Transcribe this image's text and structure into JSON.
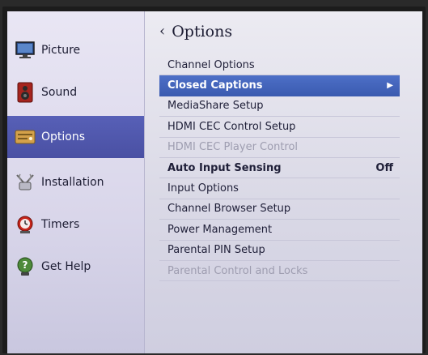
{
  "sidebar": {
    "items": [
      {
        "label": "Picture",
        "icon": "picture-icon"
      },
      {
        "label": "Sound",
        "icon": "speaker-icon"
      },
      {
        "label": "Options",
        "icon": "options-icon"
      },
      {
        "label": "Installation",
        "icon": "antenna-icon"
      },
      {
        "label": "Timers",
        "icon": "timer-icon"
      },
      {
        "label": "Get Help",
        "icon": "help-icon"
      }
    ],
    "active_index": 2
  },
  "main": {
    "title": "Options",
    "back_icon": "chevron-left-icon",
    "menu": [
      {
        "label": "Channel Options"
      },
      {
        "label": "Closed Captions",
        "selected": true,
        "has_submenu": true
      },
      {
        "label": "MediaShare Setup"
      },
      {
        "label": "HDMI CEC Control Setup"
      },
      {
        "label": "HDMI CEC Player Control",
        "disabled": true
      },
      {
        "label": "Auto Input Sensing",
        "value": "Off"
      },
      {
        "label": "Input Options"
      },
      {
        "label": "Channel Browser Setup"
      },
      {
        "label": "Power Management"
      },
      {
        "label": "Parental PIN Setup"
      },
      {
        "label": "Parental Control and Locks",
        "disabled": true
      }
    ]
  },
  "colors": {
    "sidebar_active": "#4a50a3",
    "menu_selected": "#3b5bb0",
    "text": "#1f1f38",
    "disabled_text": "#9e9db0"
  }
}
